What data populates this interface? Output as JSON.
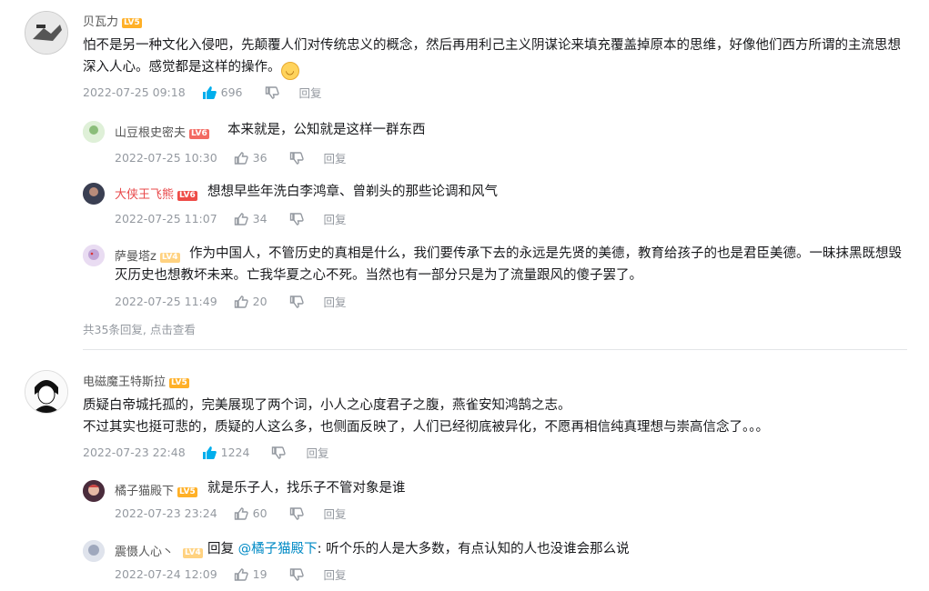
{
  "comments": [
    {
      "user": "贝瓦力",
      "level": "LV5",
      "text": "怕不是另一种文化入侵吧，先颠覆人们对传统忠义的概念，然后再用利己主义阴谋论来填充覆盖掉原本的思维，好像他们西方所谓的主流思想深入人心。感觉都是这样的操作。",
      "time": "2022-07-25 09:18",
      "likes": "696",
      "reply_label": "回复",
      "replies": [
        {
          "user": "山豆根史密夫",
          "level": "LV6",
          "text": "本来就是，公知就是这样一群东西",
          "time": "2022-07-25 10:30",
          "likes": "36",
          "reply_label": "回复"
        },
        {
          "user": "大侠王飞熊",
          "level": "LV6",
          "text": "想想早些年洗白李鸿章、曾剃头的那些论调和风气",
          "time": "2022-07-25 11:07",
          "likes": "34",
          "reply_label": "回复"
        },
        {
          "user": "萨曼塔z",
          "level": "LV4",
          "text": "作为中国人，不管历史的真相是什么，我们要传承下去的永远是先贤的美德，教育给孩子的也是君臣美德。一昧抹黑既想毁灭历史也想教坏未来。亡我华夏之心不死。当然也有一部分只是为了流量跟风的傻子罢了。",
          "time": "2022-07-25 11:49",
          "likes": "20",
          "reply_label": "回复"
        }
      ],
      "more": "共35条回复, 点击查看"
    },
    {
      "user": "电磁魔王特斯拉",
      "level": "LV5",
      "text_line1": "质疑白帝城托孤的，完美展现了两个词，小人之心度君子之腹，燕雀安知鸿鹄之志。",
      "text_line2": "不过其实也挺可悲的，质疑的人这么多，也侧面反映了，人们已经彻底被异化，不愿再相信纯真理想与崇高信念了。。。",
      "time": "2022-07-23 22:48",
      "likes": "1224",
      "reply_label": "回复",
      "replies": [
        {
          "user": "橘子猫殿下",
          "level": "LV5",
          "text": "就是乐子人，找乐子不管对象是谁",
          "time": "2022-07-23 23:24",
          "likes": "60",
          "reply_label": "回复"
        },
        {
          "user": "震慑人心丶",
          "level": "LV4",
          "reply_word": "回复",
          "mention": "@橘子猫殿下",
          "text": ": 听个乐的人是大多数，有点认知的人也没谁会那么说",
          "time": "2022-07-24 12:09",
          "likes": "19",
          "reply_label": "回复"
        }
      ]
    }
  ]
}
